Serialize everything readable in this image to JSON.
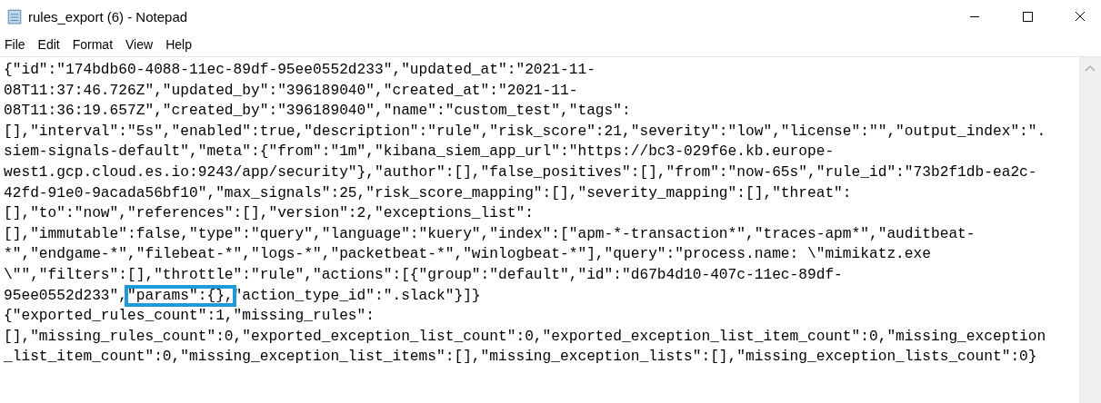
{
  "window": {
    "title": "rules_export (6) - Notepad"
  },
  "menu": [
    {
      "label": "File"
    },
    {
      "label": "Edit"
    },
    {
      "label": "Format"
    },
    {
      "label": "View"
    },
    {
      "label": "Help"
    }
  ],
  "lines": [
    {
      "segments": [
        {
          "text": "{\"id\":\"174bdb60-4088-11ec-89df-95ee0552d233\",\"updated_at\":\"2021-11-",
          "highlighted": false
        }
      ]
    },
    {
      "segments": [
        {
          "text": "08T11:37:46.726Z\",\"updated_by\":\"396189040\",\"created_at\":\"2021-11-",
          "highlighted": false
        }
      ]
    },
    {
      "segments": [
        {
          "text": "08T11:36:19.657Z\",\"created_by\":\"396189040\",\"name\":\"custom_test\",\"tags\":",
          "highlighted": false
        }
      ]
    },
    {
      "segments": [
        {
          "text": "[],\"interval\":\"5s\",\"enabled\":true,\"description\":\"rule\",\"risk_score\":21,\"severity\":\"low\",\"license\":\"\",\"output_index\":\".",
          "highlighted": false
        }
      ]
    },
    {
      "segments": [
        {
          "text": "siem-signals-default\",\"meta\":{\"from\":\"1m\",\"kibana_siem_app_url\":\"https://bc3-029f6e.kb.europe-",
          "highlighted": false
        }
      ]
    },
    {
      "segments": [
        {
          "text": "west1.gcp.cloud.es.io:9243/app/security\"},\"author\":[],\"false_positives\":[],\"from\":\"now-65s\",\"rule_id\":\"73b2f1db-ea2c-",
          "highlighted": false
        }
      ]
    },
    {
      "segments": [
        {
          "text": "42fd-91e0-9acada56bf10\",\"max_signals\":25,\"risk_score_mapping\":[],\"severity_mapping\":[],\"threat\":",
          "highlighted": false
        }
      ]
    },
    {
      "segments": [
        {
          "text": "[],\"to\":\"now\",\"references\":[],\"version\":2,\"exceptions_list\":",
          "highlighted": false
        }
      ]
    },
    {
      "segments": [
        {
          "text": "[],\"immutable\":false,\"type\":\"query\",\"language\":\"kuery\",\"index\":[\"apm-*-transaction*\",\"traces-apm*\",\"auditbeat-",
          "highlighted": false
        }
      ]
    },
    {
      "segments": [
        {
          "text": "*\",\"endgame-*\",\"filebeat-*\",\"logs-*\",\"packetbeat-*\",\"winlogbeat-*\"],\"query\":\"process.name: \\\"mimikatz.exe",
          "highlighted": false
        }
      ]
    },
    {
      "segments": [
        {
          "text": "\\\"\",\"filters\":[],\"throttle\":\"rule\",\"actions\":[{\"group\":\"default\",\"id\":\"d67b4d10-407c-11ec-89df-",
          "highlighted": false
        }
      ]
    },
    {
      "segments": [
        {
          "text": "95ee0552d233\",",
          "highlighted": false
        },
        {
          "text": "\"params\":{},",
          "highlighted": true
        },
        {
          "text": "\"action_type_id\":\".slack\"}]}",
          "highlighted": false
        }
      ]
    },
    {
      "segments": [
        {
          "text": "{\"exported_rules_count\":1,\"missing_rules\":",
          "highlighted": false
        }
      ]
    },
    {
      "segments": [
        {
          "text": "[],\"missing_rules_count\":0,\"exported_exception_list_count\":0,\"exported_exception_list_item_count\":0,\"missing_exception",
          "highlighted": false
        }
      ]
    },
    {
      "segments": [
        {
          "text": "_list_item_count\":0,\"missing_exception_list_items\":[],\"missing_exception_lists\":[],\"missing_exception_lists_count\":0}",
          "highlighted": false
        }
      ]
    }
  ]
}
